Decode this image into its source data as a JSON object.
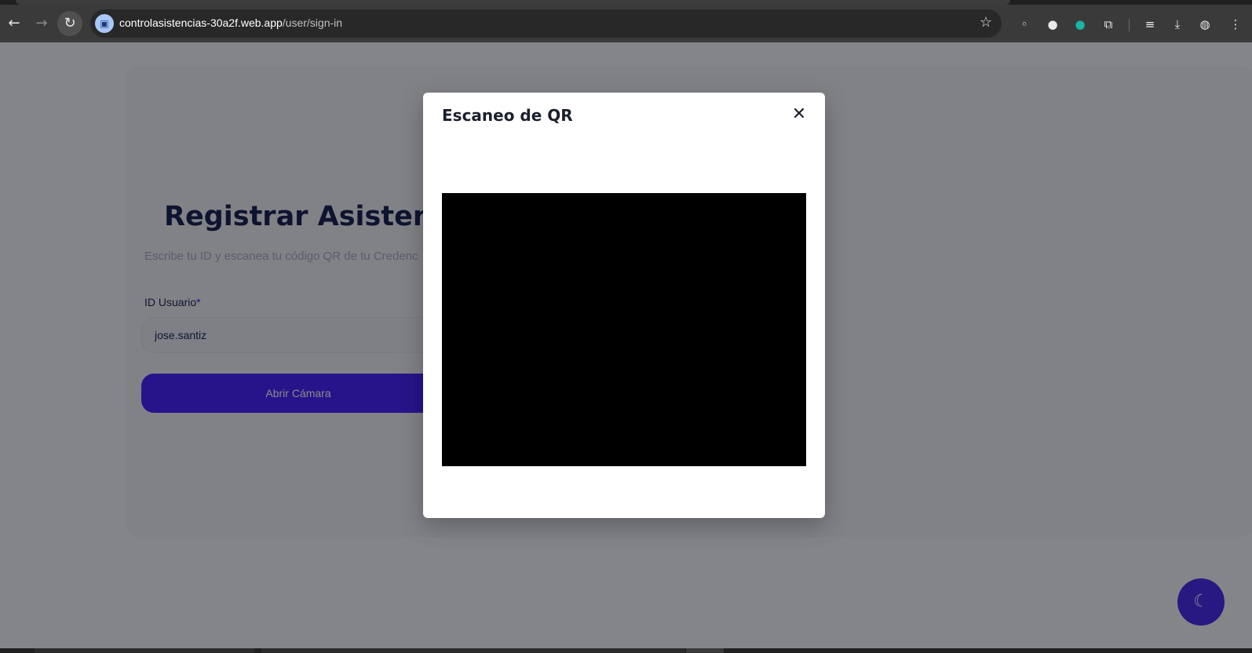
{
  "browser": {
    "url_host": "controlasistencias-30a2f.web.app",
    "url_path": "/user/sign-in"
  },
  "page": {
    "title": "Registrar Asistencia",
    "subtitle": "Escribe tu ID y escanea tu código QR de tu Credenc",
    "id_label": "ID Usuario",
    "required_mark": "*",
    "id_value": "jose.santiz",
    "open_camera_label": "Abrir Cámara"
  },
  "modal": {
    "title": "Escaneo de QR"
  },
  "icons": {
    "back": "arrow-left-icon",
    "forward": "arrow-right-icon",
    "reload": "reload-icon",
    "site": "camera-site-icon",
    "bookmark": "star-icon",
    "close": "close-icon",
    "theme": "moon-icon"
  },
  "colors": {
    "accent": "#4318ff",
    "heading": "#1b2559",
    "muted": "#a3aed0"
  }
}
